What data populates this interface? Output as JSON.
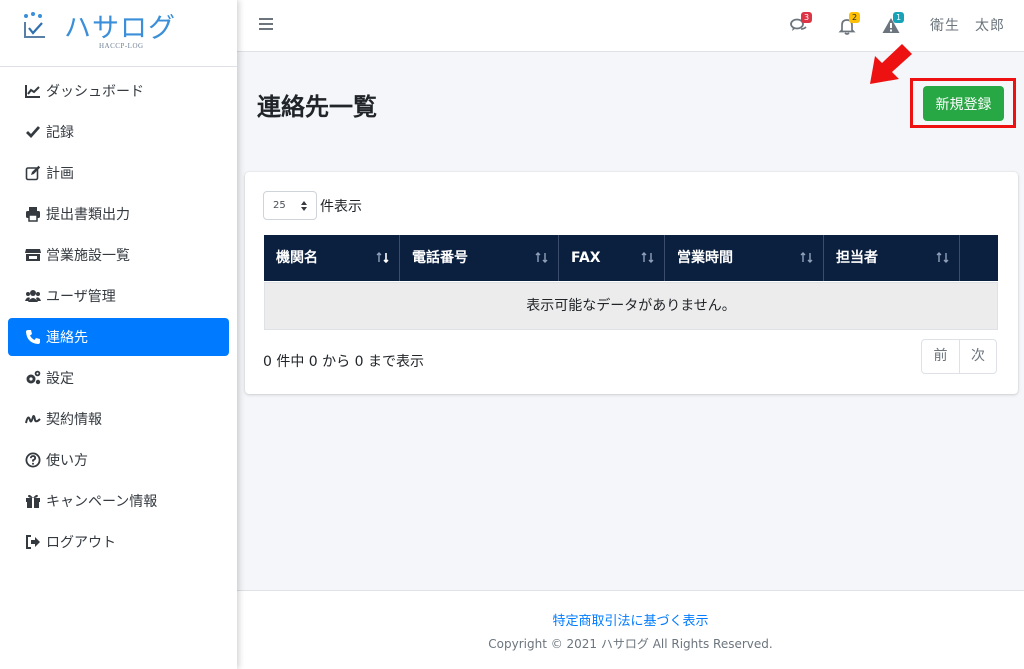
{
  "brand": {
    "name": "ハサログ",
    "sub": "HACCP-LOG"
  },
  "sidebar": {
    "items": [
      {
        "label": "ダッシュボード",
        "icon": "chart-line-icon"
      },
      {
        "label": "記録",
        "icon": "check-icon"
      },
      {
        "label": "計画",
        "icon": "edit-icon"
      },
      {
        "label": "提出書類出力",
        "icon": "print-icon"
      },
      {
        "label": "営業施設一覧",
        "icon": "store-icon"
      },
      {
        "label": "ユーザ管理",
        "icon": "users-icon"
      },
      {
        "label": "連絡先",
        "icon": "phone-icon",
        "active": true
      },
      {
        "label": "設定",
        "icon": "cogs-icon"
      },
      {
        "label": "契約情報",
        "icon": "signature-icon"
      },
      {
        "label": "使い方",
        "icon": "question-circle-icon"
      },
      {
        "label": "キャンペーン情報",
        "icon": "gift-icon"
      },
      {
        "label": "ログアウト",
        "icon": "sign-out-icon"
      }
    ]
  },
  "header": {
    "messages_count": "3",
    "notifications_count": "2",
    "alerts_count": "1",
    "user_name": "衛生　太郎",
    "colors": {
      "messages_badge": "#dc3545",
      "notifications_badge": "#ffc107",
      "alerts_badge": "#17a2b8"
    }
  },
  "page": {
    "title": "連絡先一覧",
    "new_button": "新規登録"
  },
  "table": {
    "length_value": "25",
    "length_suffix": "件表示",
    "columns": [
      "機関名",
      "電話番号",
      "FAX",
      "営業時間",
      "担当者"
    ],
    "empty_message": "表示可能なデータがありません。",
    "info": "0 件中 0 から 0 まで表示",
    "prev": "前",
    "next": "次"
  },
  "footer": {
    "link": "特定商取引法に基づく表示",
    "copyright": "Copyright © 2021 ハサログ All Rights Reserved."
  }
}
